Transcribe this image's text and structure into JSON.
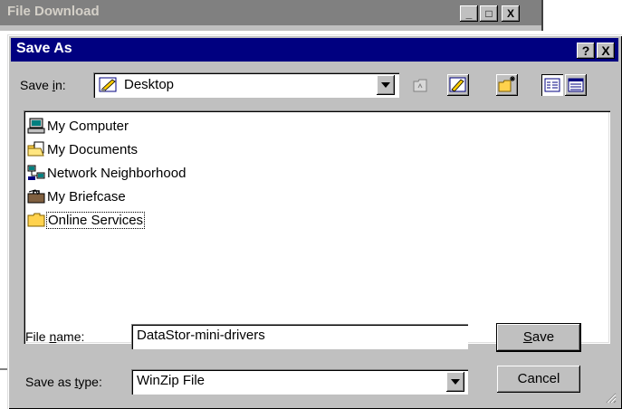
{
  "background_window": {
    "title": "File Download",
    "buttons": {
      "minimize": "_",
      "maximize": "□",
      "close": "X"
    }
  },
  "dialog": {
    "title": "Save As",
    "help_label": "?",
    "close_label": "X",
    "save_in": {
      "label_pre": "Save ",
      "label_mnemonic": "i",
      "label_post": "n:",
      "value": "Desktop"
    },
    "toolbar": {
      "icons": [
        "up-folder-icon",
        "desktop-shortcut-icon",
        "new-folder-icon",
        "list-view-icon",
        "details-view-icon"
      ]
    },
    "files": [
      {
        "name": "My Computer",
        "icon": "computer-icon"
      },
      {
        "name": "My Documents",
        "icon": "documents-folder-icon"
      },
      {
        "name": "Network Neighborhood",
        "icon": "network-icon"
      },
      {
        "name": "My Briefcase",
        "icon": "briefcase-icon"
      },
      {
        "name": "Online Services",
        "icon": "folder-icon",
        "selected": true
      }
    ],
    "file_name": {
      "label_pre": "File ",
      "label_mnemonic": "n",
      "label_post": "ame:",
      "value": "DataStor-mini-drivers"
    },
    "save_as_type": {
      "label_pre": "Save as ",
      "label_mnemonic": "t",
      "label_post": "ype:",
      "value": "WinZip File"
    },
    "save_button": {
      "mnemonic": "S",
      "rest": "ave"
    },
    "cancel_button": "Cancel"
  },
  "colors": {
    "titlebar": "#000080",
    "face": "#c0c0c0",
    "inactive_titlebar": "#808080"
  }
}
